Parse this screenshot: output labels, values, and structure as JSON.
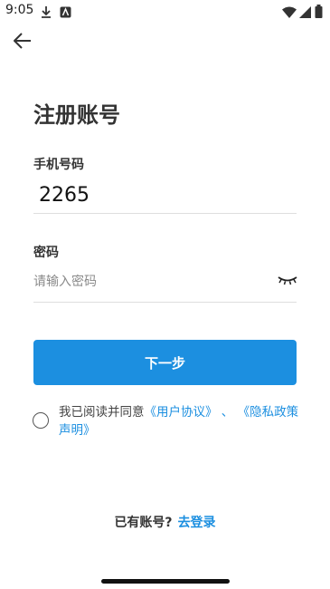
{
  "status_bar": {
    "time": "9:05"
  },
  "title": "注册账号",
  "phone": {
    "label": "手机号码",
    "value": "2265"
  },
  "password": {
    "label": "密码",
    "placeholder": "请输入密码"
  },
  "next_button": "下一步",
  "agreement": {
    "prefix": "我已阅读并同意",
    "user_agreement": "《用户协议》",
    "separator": "、",
    "privacy_policy": "《隐私政策声明》"
  },
  "login_prompt": {
    "text": "已有账号?",
    "link": "去登录"
  },
  "colors": {
    "accent": "#1c8fe0"
  }
}
